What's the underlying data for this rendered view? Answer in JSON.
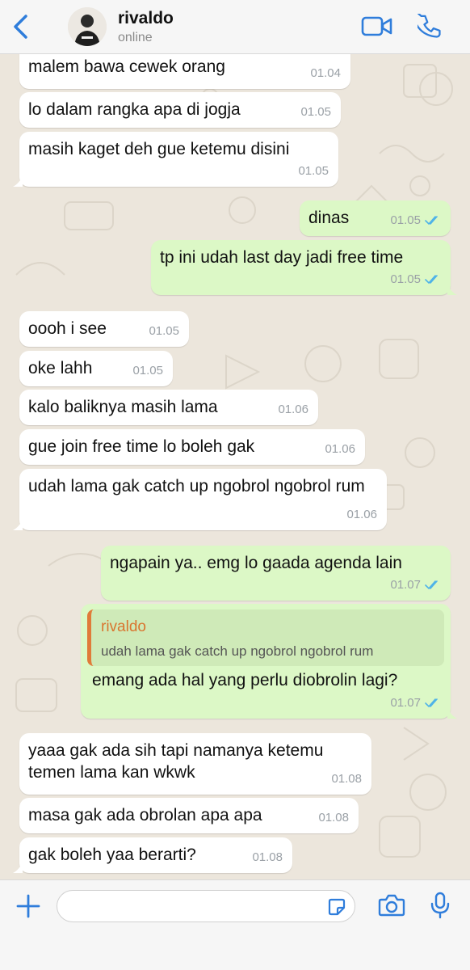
{
  "header": {
    "contact_name": "rivaldo",
    "status": "online"
  },
  "messages": [
    {
      "dir": "in",
      "text": "malem bawa cewek orang",
      "time": "01.04"
    },
    {
      "dir": "in",
      "text": "lo dalam rangka apa di jogja",
      "time": "01.05"
    },
    {
      "dir": "in",
      "text": "masih kaget deh gue ketemu disini",
      "time": "01.05"
    },
    {
      "dir": "out",
      "text": "dinas",
      "time": "01.05",
      "read": true
    },
    {
      "dir": "out",
      "text": "tp ini udah last day jadi free time",
      "time": "01.05",
      "read": true
    },
    {
      "dir": "in",
      "text": "oooh i see",
      "time": "01.05"
    },
    {
      "dir": "in",
      "text": "oke lahh",
      "time": "01.05"
    },
    {
      "dir": "in",
      "text": "kalo baliknya masih lama",
      "time": "01.06"
    },
    {
      "dir": "in",
      "text": "gue join free time lo boleh gak",
      "time": "01.06"
    },
    {
      "dir": "in",
      "text": "udah lama gak catch up ngobrol ngobrol rum",
      "time": "01.06"
    },
    {
      "dir": "out",
      "text": "ngapain ya.. emg lo gaada agenda lain",
      "time": "01.07",
      "read": true
    },
    {
      "dir": "out",
      "text": "emang ada hal yang perlu diobrolin lagi?",
      "time": "01.07",
      "read": true,
      "quote": {
        "name": "rivaldo",
        "text": "udah lama gak catch up ngobrol ngobrol rum"
      }
    },
    {
      "dir": "in",
      "text": "yaaa gak ada sih tapi namanya ketemu temen lama kan wkwk",
      "time": "01.08"
    },
    {
      "dir": "in",
      "text": "masa gak ada obrolan apa apa",
      "time": "01.08"
    },
    {
      "dir": "in",
      "text": "gak boleh yaa berarti?",
      "time": "01.08"
    }
  ],
  "composer": {
    "placeholder": ""
  },
  "colors": {
    "accent": "#2f7ddb",
    "incoming_bubble": "#ffffff",
    "outgoing_bubble": "#dcf8c6",
    "quote_name": "#d9752f",
    "read_tick": "#4fb3e8"
  },
  "icons": [
    "back-chevron-icon",
    "video-call-icon",
    "phone-icon",
    "attach-plus-icon",
    "sticker-icon",
    "camera-icon",
    "microphone-icon"
  ]
}
